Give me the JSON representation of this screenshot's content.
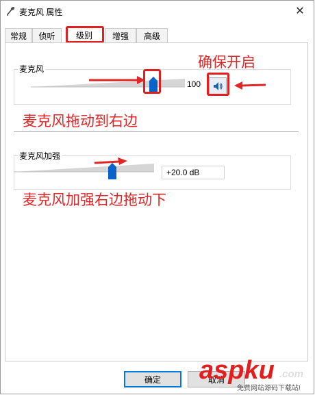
{
  "window": {
    "title": "麦克风 属性",
    "close_glyph": "✕"
  },
  "tabs": [
    {
      "label": "常规",
      "active": false
    },
    {
      "label": "侦听",
      "active": false
    },
    {
      "label": "级别",
      "active": true
    },
    {
      "label": "增强",
      "active": false
    },
    {
      "label": "高级",
      "active": false
    }
  ],
  "microphone": {
    "label": "麦克风",
    "value": "100",
    "level": 0.85
  },
  "boost": {
    "label": "麦克风加强",
    "value": "+20.0 dB",
    "level": 0.65
  },
  "annotations": {
    "ensure_on": "确保开启",
    "drag_right": "麦克风拖动到右边",
    "boost_drag_right": "麦克风加强右边拖动下"
  },
  "buttons": {
    "ok": "确定",
    "cancel": "取消"
  },
  "watermark": {
    "main": "aspku",
    "suffix": ".com",
    "sub": "免费网站源码下载站!"
  },
  "colors": {
    "annotation_red": "#e02626",
    "thumb_blue": "#0a63c9",
    "default_button_border": "#0078d7"
  }
}
